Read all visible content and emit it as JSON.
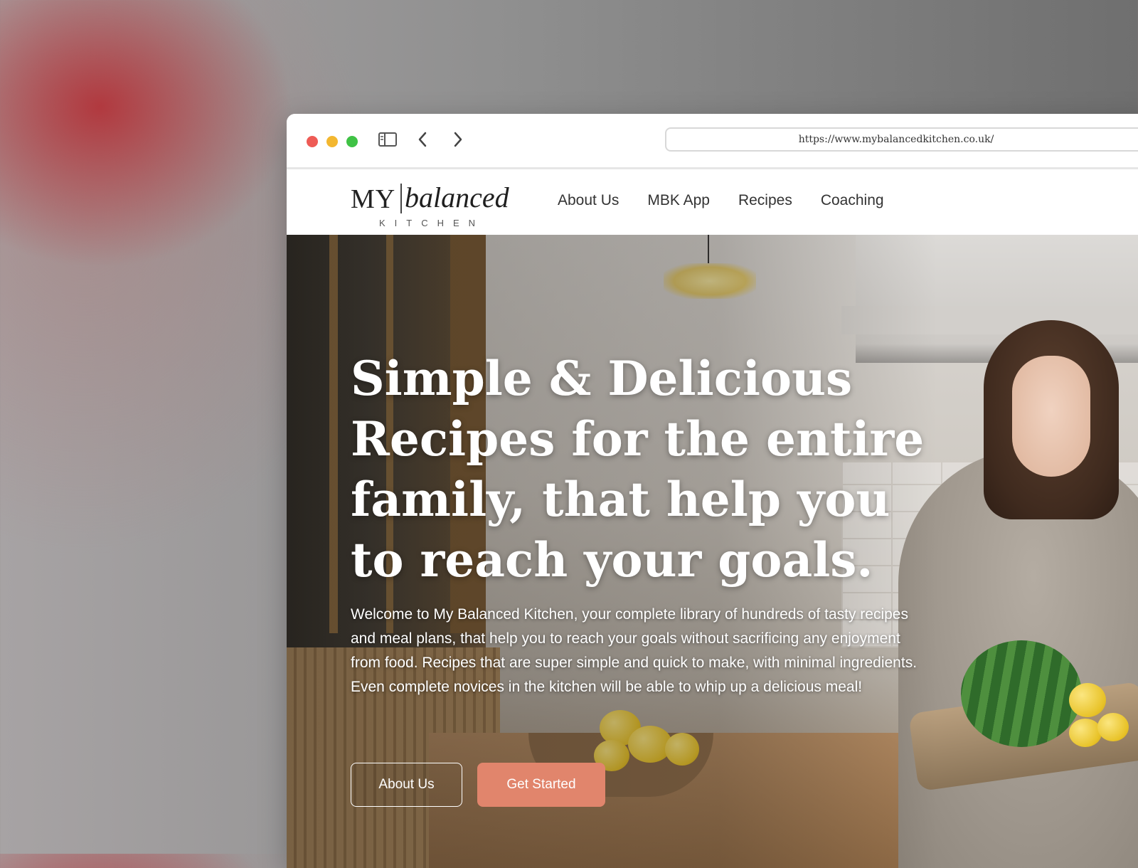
{
  "browser": {
    "url": "https://www.mybalancedkitchen.co.uk/"
  },
  "site": {
    "logo": {
      "my": "MY",
      "balanced": "balanced",
      "kitchen": "KITCHEN"
    },
    "nav": [
      {
        "label": "About Us"
      },
      {
        "label": "MBK App"
      },
      {
        "label": "Recipes"
      },
      {
        "label": "Coaching"
      }
    ]
  },
  "hero": {
    "title": "Simple & Delicious Recipes for the entire family, that help you to reach your goals.",
    "description": "Welcome to My Balanced Kitchen, your complete library of hundreds of tasty recipes and meal plans, that help you to reach your goals without sacrificing any enjoyment from food. Recipes that are super simple and quick to make, with minimal ingredients. Even complete novices in the kitchen will be able to whip up a delicious meal!",
    "buttons": {
      "secondary": "About Us",
      "primary": "Get Started"
    }
  },
  "colors": {
    "accent": "#e1856c",
    "dot_close": "#ee5b55",
    "dot_minimize": "#f3b730",
    "dot_zoom": "#3fc245"
  },
  "icons": [
    "sidebar-icon",
    "back-arrow-icon",
    "forward-arrow-icon"
  ]
}
